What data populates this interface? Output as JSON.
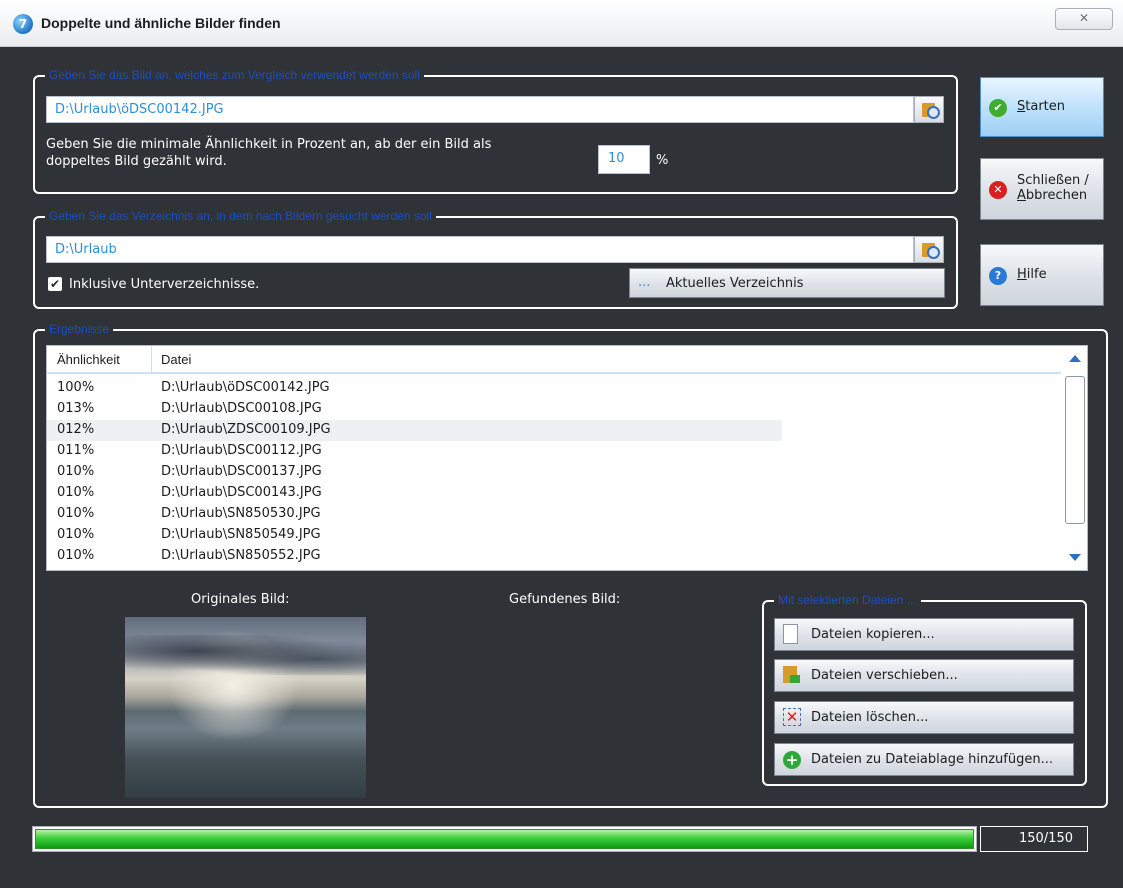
{
  "window": {
    "title": "Doppelte und ähnliche Bilder finden",
    "close_glyph": "✕",
    "app_icon_glyph": "7"
  },
  "reference_group": {
    "legend": "Geben Sie das Bild an, welches zum Vergleich verwendet werden soll",
    "path_value": "D:\\Urlaub\\öDSC00142.JPG",
    "similarity_label": "Geben Sie die minimale Ähnlichkeit in Prozent an, ab der ein Bild als doppeltes Bild gezählt wird.",
    "similarity_value": "10",
    "percent_sign": "%"
  },
  "directory_group": {
    "legend": "Geben Sie das Verzeichnis an, in dem nach Bildern gesucht werden soll",
    "path_value": "D:\\Urlaub",
    "include_subdirs_label": "Inklusive Unterverzeichnisse.",
    "include_subdirs_checked": true,
    "current_dir_button": "Aktuelles Verzeichnis",
    "current_dir_dots": "..."
  },
  "side_buttons": {
    "start_mnemonic": "S",
    "start_rest": "tarten",
    "close_line1": "Schließen /",
    "close_line2_mnemonic": "A",
    "close_line2_rest": "bbrechen",
    "help_mnemonic": "H",
    "help_rest": "ilfe"
  },
  "results_group": {
    "legend": "Ergebnisse",
    "columns": [
      "Ähnlichkeit",
      "Datei"
    ],
    "rows": [
      {
        "similarity": "100%",
        "file": "D:\\Urlaub\\öDSC00142.JPG"
      },
      {
        "similarity": "013%",
        "file": "D:\\Urlaub\\DSC00108.JPG"
      },
      {
        "similarity": "012%",
        "file": "D:\\Urlaub\\ZDSC00109.JPG"
      },
      {
        "similarity": "011%",
        "file": "D:\\Urlaub\\DSC00112.JPG"
      },
      {
        "similarity": "010%",
        "file": "D:\\Urlaub\\DSC00137.JPG"
      },
      {
        "similarity": "010%",
        "file": "D:\\Urlaub\\DSC00143.JPG"
      },
      {
        "similarity": "010%",
        "file": "D:\\Urlaub\\SN850530.JPG"
      },
      {
        "similarity": "010%",
        "file": "D:\\Urlaub\\SN850549.JPG"
      },
      {
        "similarity": "010%",
        "file": "D:\\Urlaub\\SN850552.JPG"
      }
    ],
    "original_caption": "Originales Bild:",
    "found_caption": "Gefundenes Bild:"
  },
  "selected_files_group": {
    "legend": "Mit selektierten Dateien ...",
    "copy_button": "Dateien kopieren...",
    "move_button": "Dateien verschieben...",
    "delete_button": "Dateien löschen...",
    "add_button": "Dateien zu Dateiablage hinzufügen..."
  },
  "progress": {
    "fraction": 1.0,
    "counter_text": "150/150"
  },
  "colors": {
    "window_bg": "#2f3236",
    "legend_text": "#1c4fbf",
    "field_text": "#2c8fd9",
    "progress_green": "#3ccf3c"
  },
  "icons": {
    "start": "checkmark-icon",
    "close": "error-x-icon",
    "help": "question-icon",
    "browse": "folder-search-icon",
    "copy": "document-icon",
    "move": "folder-move-icon",
    "delete": "delete-x-icon",
    "add": "plus-circle-icon"
  }
}
